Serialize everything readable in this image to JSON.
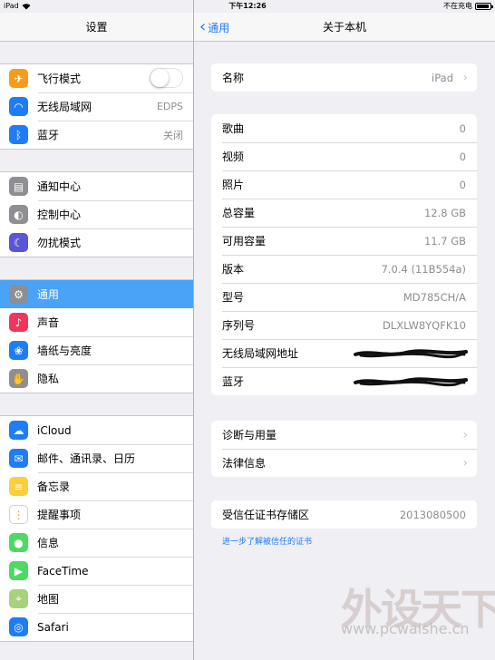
{
  "status_bar": {
    "device": "iPad",
    "time": "下午12:26",
    "charging_text": "不在充电",
    "battery_level": 0.95
  },
  "master": {
    "title": "设置",
    "groups": [
      [
        {
          "label": "飞行模式",
          "icon": "airplane-icon",
          "color": "#f89b1c",
          "toggle": false
        },
        {
          "label": "无线局域网",
          "icon": "wifi-icon",
          "color": "#1e7cf7",
          "value": "EDPS"
        },
        {
          "label": "蓝牙",
          "icon": "bluetooth-icon",
          "color": "#1e7cf7",
          "value": "关闭"
        }
      ],
      [
        {
          "label": "通知中心",
          "icon": "notification-center-icon",
          "color": "#8e8e93"
        },
        {
          "label": "控制中心",
          "icon": "control-center-icon",
          "color": "#8e8e93"
        },
        {
          "label": "勿扰模式",
          "icon": "moon-icon",
          "color": "#5856d6"
        }
      ],
      [
        {
          "label": "通用",
          "icon": "gear-icon",
          "color": "#8e8e93",
          "selected": true
        },
        {
          "label": "声音",
          "icon": "sound-icon",
          "color": "#f0365a"
        },
        {
          "label": "墙纸与亮度",
          "icon": "flower-icon",
          "color": "#1e7cf7"
        },
        {
          "label": "隐私",
          "icon": "hand-icon",
          "color": "#8e8e93"
        }
      ],
      [
        {
          "label": "iCloud",
          "icon": "cloud-icon",
          "color": "#1e7cf7"
        },
        {
          "label": "邮件、通讯录、日历",
          "icon": "mail-icon",
          "color": "#1e7cf7"
        },
        {
          "label": "备忘录",
          "icon": "notes-icon",
          "color": "#fbce3b"
        },
        {
          "label": "提醒事项",
          "icon": "reminders-icon",
          "color": "#ffffff"
        },
        {
          "label": "信息",
          "icon": "messages-icon",
          "color": "#4cd964"
        },
        {
          "label": "FaceTime",
          "icon": "facetime-icon",
          "color": "#4cd964"
        },
        {
          "label": "地图",
          "icon": "maps-icon",
          "color": "#a6d27c"
        },
        {
          "label": "Safari",
          "icon": "safari-icon",
          "color": "#1e7cf7"
        }
      ]
    ]
  },
  "detail": {
    "back_label": "通用",
    "title": "关于本机",
    "name_row": {
      "label": "名称",
      "value": "iPad"
    },
    "info_rows": [
      {
        "label": "歌曲",
        "value": "0"
      },
      {
        "label": "视频",
        "value": "0"
      },
      {
        "label": "照片",
        "value": "0"
      },
      {
        "label": "总容量",
        "value": "12.8 GB"
      },
      {
        "label": "可用容量",
        "value": "11.7 GB"
      },
      {
        "label": "版本",
        "value": "7.0.4 (11B554a)"
      },
      {
        "label": "型号",
        "value": "MD785CH/A"
      },
      {
        "label": "序列号",
        "value": "DLXLW8YQFK10"
      },
      {
        "label": "无线局域网地址",
        "redacted": true
      },
      {
        "label": "蓝牙",
        "redacted": true
      }
    ],
    "nav_rows": [
      {
        "label": "诊断与用量"
      },
      {
        "label": "法律信息"
      }
    ],
    "trust_row": {
      "label": "受信任证书存储区",
      "value": "2013080500"
    },
    "trust_link": "进一步了解被信任的证书"
  },
  "watermark": {
    "brand": "外设天下",
    "url": "www.pcwaishe.cn"
  }
}
